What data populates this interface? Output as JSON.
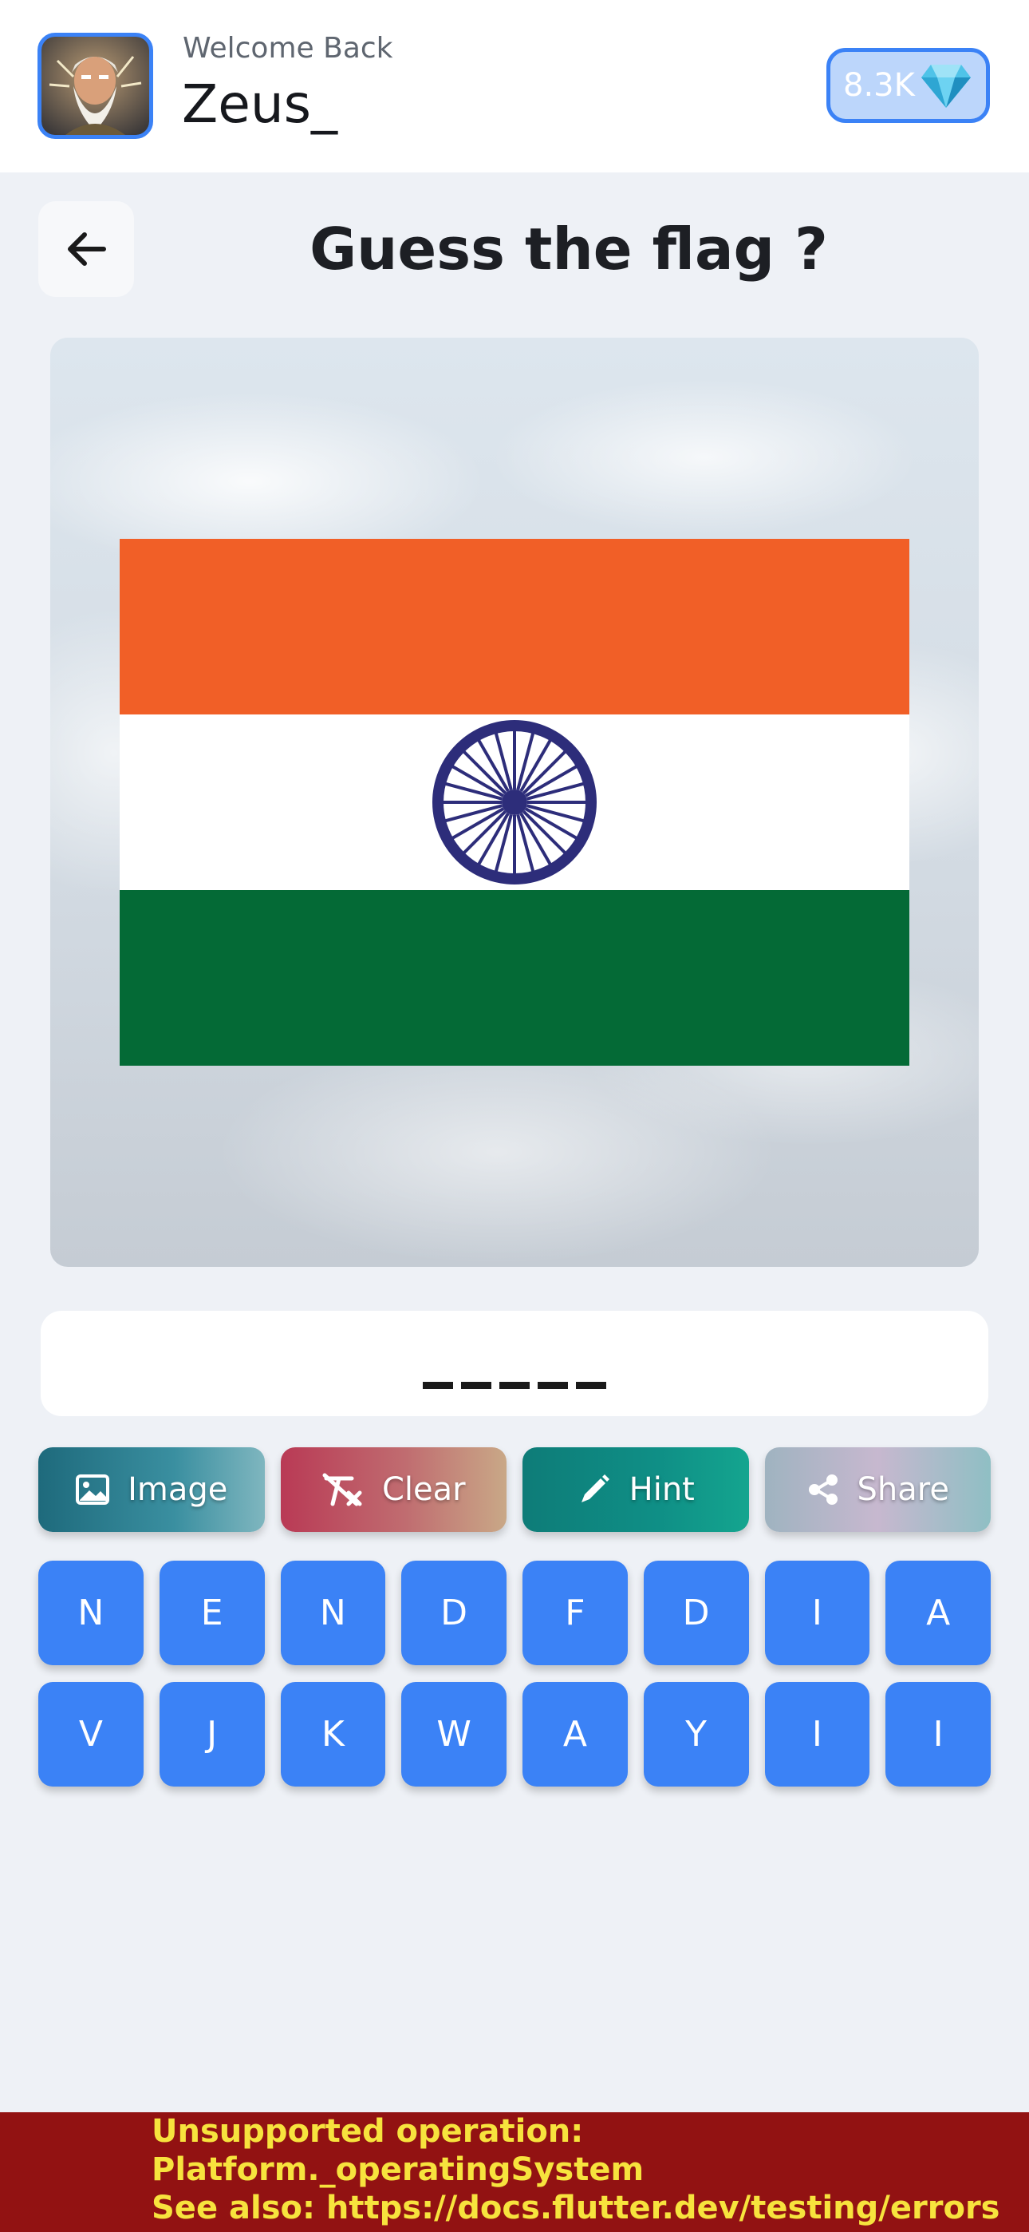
{
  "header": {
    "welcome": "Welcome Back",
    "username": "Zeus_",
    "gems": "8.3K",
    "gem_icon": "diamond-icon",
    "avatar_icon": "avatar"
  },
  "title": {
    "back_icon": "arrow-left-icon",
    "text": "Guess the flag ?"
  },
  "flag": {
    "colors": {
      "saffron": "#f15f27",
      "white": "#ffffff",
      "green": "#046a36",
      "chakra": "#2d2d7a"
    }
  },
  "answer": {
    "blanks": "_ _ _ _ _"
  },
  "actions": [
    {
      "label": "Image",
      "icon": "image-icon"
    },
    {
      "label": "Clear",
      "icon": "clear-format-icon"
    },
    {
      "label": "Hint",
      "icon": "pencil-icon"
    },
    {
      "label": "Share",
      "icon": "share-icon"
    }
  ],
  "keys": {
    "row1": [
      "N",
      "E",
      "N",
      "D",
      "F",
      "D",
      "I",
      "A"
    ],
    "row2": [
      "V",
      "J",
      "K",
      "W",
      "A",
      "Y",
      "I",
      "I"
    ]
  },
  "error": {
    "line1": "Unsupported operation:",
    "line2": "Platform._operatingSystem",
    "line3": "See also: https://docs.flutter.dev/testing/errors"
  },
  "colors": {
    "accent": "#3b82f6",
    "background": "#eef1f6",
    "error_bg": "#921212",
    "error_text": "#f7e33d"
  }
}
